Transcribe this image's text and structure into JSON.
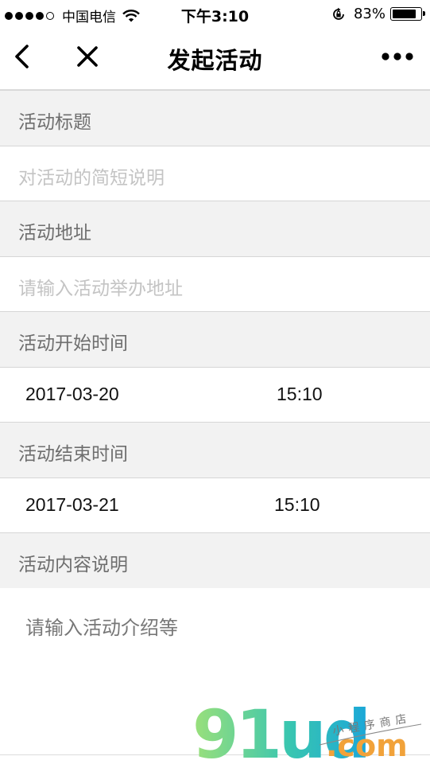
{
  "status": {
    "carrier": "中国电信",
    "time": "下午3:10",
    "battery": "83%",
    "battery_level": 0.83
  },
  "nav": {
    "title": "发起活动"
  },
  "form": {
    "title_label": "活动标题",
    "title_placeholder": "对活动的简短说明",
    "address_label": "活动地址",
    "address_placeholder": "请输入活动举办地址",
    "start_label": "活动开始时间",
    "start_date": "2017-03-20",
    "start_time": "15:10",
    "end_label": "活动结束时间",
    "end_date": "2017-03-21",
    "end_time": "15:10",
    "content_label": "活动内容说明",
    "content_placeholder": "请输入活动介绍等"
  },
  "watermark": {
    "logo": "91ud",
    "domain": ".com",
    "tagline": "小程序商店"
  }
}
